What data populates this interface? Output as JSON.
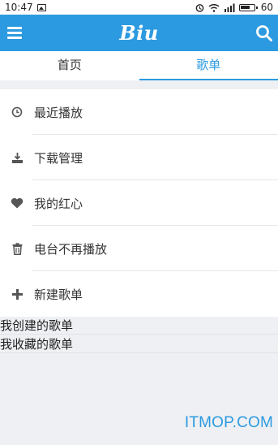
{
  "status_bar": {
    "time": "10:47",
    "battery": "60"
  },
  "app_bar": {
    "logo": "Biu"
  },
  "tabs": [
    {
      "label": "首页",
      "active": false
    },
    {
      "label": "歌单",
      "active": true
    }
  ],
  "menu": {
    "items": [
      {
        "label": "最近播放",
        "icon": "clock-icon"
      },
      {
        "label": "下载管理",
        "icon": "download-icon"
      },
      {
        "label": "我的红心",
        "icon": "heart-icon"
      },
      {
        "label": "电台不再播放",
        "icon": "trash-icon"
      },
      {
        "label": "新建歌单",
        "icon": "plus-icon"
      }
    ]
  },
  "sections": {
    "created": "我创建的歌单",
    "collected": "我收藏的歌单"
  },
  "watermark": "ITMOP.COM",
  "colors": {
    "accent": "#2c9ae0",
    "background": "#eef0f3"
  }
}
